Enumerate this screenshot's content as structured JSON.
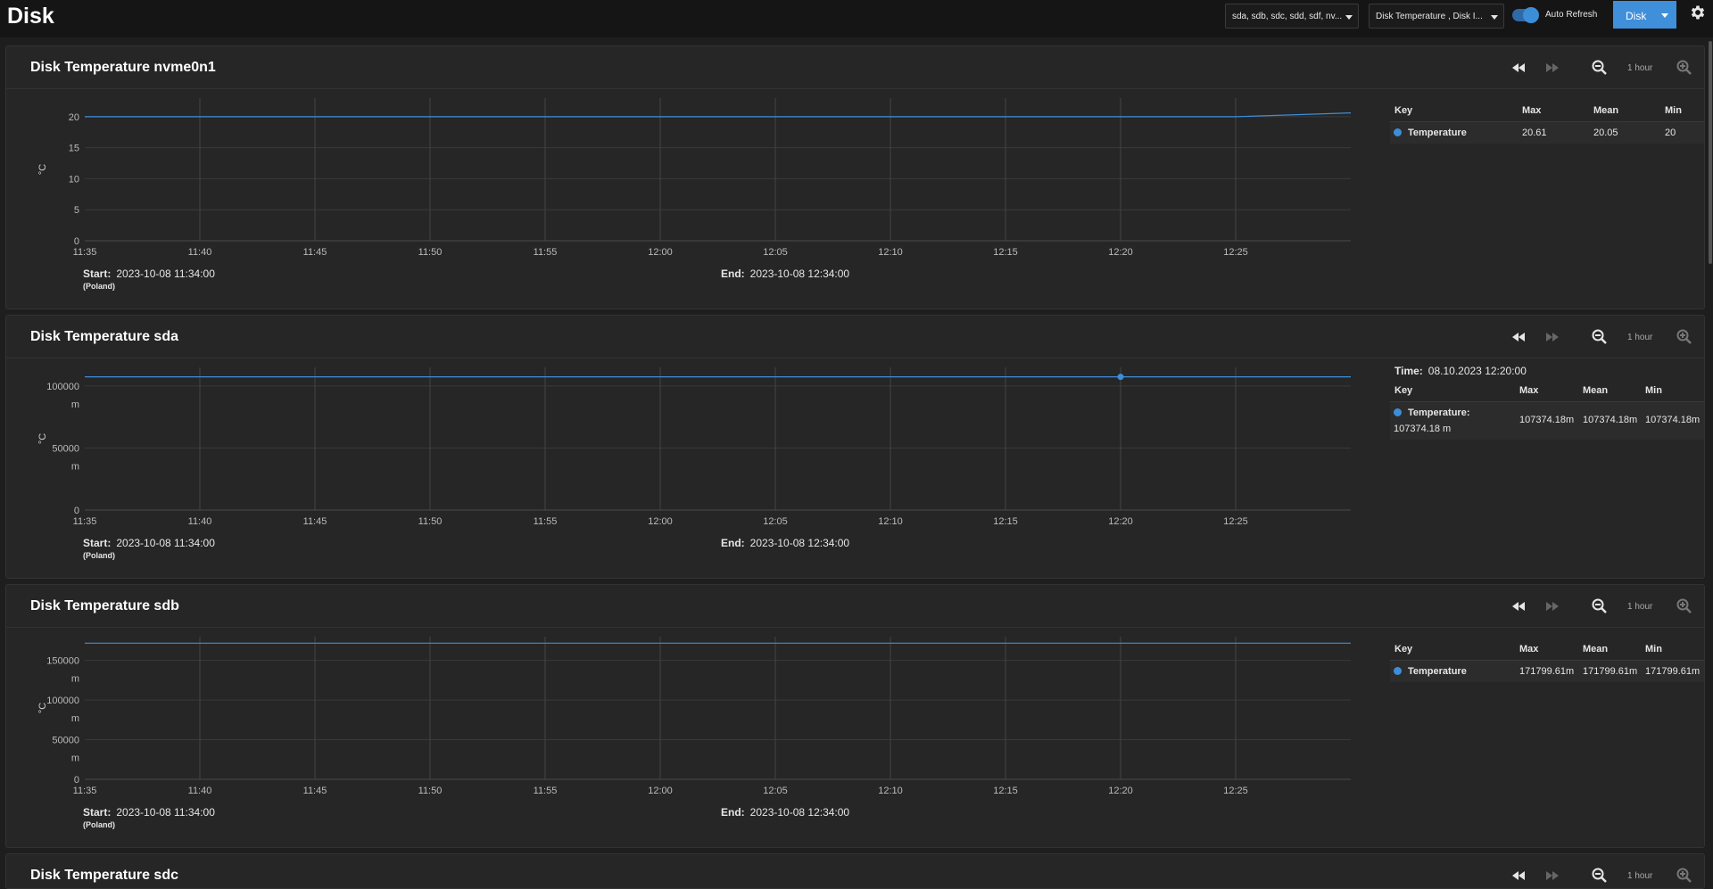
{
  "header": {
    "title": "Disk",
    "disk_select": "sda, sdb, sdc, sdd, sdf, nv...",
    "metric_select": "Disk Temperature , Disk I...",
    "auto_refresh_label": "Auto Refresh",
    "auto_refresh_on": true,
    "disk_button": "Disk"
  },
  "accent": "#3f8fdb",
  "series_color": "#3d8ed9",
  "icons": [
    "rewind-icon",
    "fast-forward-icon",
    "zoom-out-icon",
    "zoom-in-icon",
    "gear-icon",
    "chevron-down-icon"
  ],
  "cards": [
    {
      "title": "Disk Temperature nvme0n1",
      "range_label": "1 hour",
      "start_label": "Start:",
      "start_value": "2023-10-08 11:34:00",
      "timezone": "(Poland)",
      "end_label": "End:",
      "end_value": "2023-10-08 12:34:00",
      "legend": {
        "headers": [
          "Key",
          "Max",
          "Mean",
          "Min"
        ],
        "rows": [
          {
            "key": "Temperature",
            "max": "20.61",
            "mean": "20.05",
            "min": "20"
          }
        ]
      }
    },
    {
      "title": "Disk Temperature sda",
      "range_label": "1 hour",
      "start_label": "Start:",
      "start_value": "2023-10-08 11:34:00",
      "timezone": "(Poland)",
      "end_label": "End:",
      "end_value": "2023-10-08 12:34:00",
      "legend": {
        "time_label": "Time:",
        "time_value": "08.10.2023 12:20:00",
        "headers": [
          "Key",
          "Max",
          "Mean",
          "Min"
        ],
        "rows": [
          {
            "key": "Temperature:",
            "key_value": "107374.18 m",
            "max": "107374.18m",
            "mean": "107374.18m",
            "min": "107374.18m"
          }
        ]
      }
    },
    {
      "title": "Disk Temperature sdb",
      "range_label": "1 hour",
      "start_label": "Start:",
      "start_value": "2023-10-08 11:34:00",
      "timezone": "(Poland)",
      "end_label": "End:",
      "end_value": "2023-10-08 12:34:00",
      "legend": {
        "headers": [
          "Key",
          "Max",
          "Mean",
          "Min"
        ],
        "rows": [
          {
            "key": "Temperature",
            "max": "171799.61m",
            "mean": "171799.61m",
            "min": "171799.61m"
          }
        ]
      }
    },
    {
      "title": "Disk Temperature sdc",
      "range_label": "1 hour"
    }
  ],
  "chart_data": [
    {
      "type": "line",
      "ylabel": "°C",
      "x_ticks": [
        "11:35",
        "11:40",
        "11:45",
        "11:50",
        "11:55",
        "12:00",
        "12:05",
        "12:10",
        "12:15",
        "12:20",
        "12:25"
      ],
      "y_ticks": [
        "20",
        "15",
        "10",
        "5",
        "0"
      ],
      "ylim": [
        0,
        23
      ],
      "xlim": [
        "11:35",
        "12:30"
      ],
      "grid": true,
      "series": [
        {
          "name": "Temperature",
          "x": [
            "11:35",
            "12:25",
            "12:30"
          ],
          "y": [
            20,
            20,
            20.61
          ]
        }
      ]
    },
    {
      "type": "line",
      "ylabel": "°C",
      "x_ticks": [
        "11:35",
        "11:40",
        "11:45",
        "11:50",
        "11:55",
        "12:00",
        "12:05",
        "12:10",
        "12:15",
        "12:20",
        "12:25"
      ],
      "y_ticks": [
        {
          "value": 100000,
          "label": "100000",
          "unit": "m"
        },
        {
          "value": 50000,
          "label": "50000",
          "unit": "m"
        },
        {
          "value": 0,
          "label": "0",
          "unit": ""
        }
      ],
      "ylim": [
        0,
        115000
      ],
      "xlim": [
        "11:35",
        "12:30"
      ],
      "grid": true,
      "hover_x": "12:20",
      "series": [
        {
          "name": "Temperature",
          "x": [
            "11:35",
            "12:30"
          ],
          "y": [
            107374.18,
            107374.18
          ]
        }
      ]
    },
    {
      "type": "line",
      "ylabel": "°C",
      "x_ticks": [
        "11:35",
        "11:40",
        "11:45",
        "11:50",
        "11:55",
        "12:00",
        "12:05",
        "12:10",
        "12:15",
        "12:20",
        "12:25"
      ],
      "y_ticks": [
        {
          "value": 150000,
          "label": "150000",
          "unit": "m"
        },
        {
          "value": 100000,
          "label": "100000",
          "unit": "m"
        },
        {
          "value": 50000,
          "label": "50000",
          "unit": "m"
        },
        {
          "value": 0,
          "label": "0",
          "unit": ""
        }
      ],
      "ylim": [
        0,
        180000
      ],
      "xlim": [
        "11:35",
        "12:30"
      ],
      "grid": true,
      "series": [
        {
          "name": "Temperature",
          "x": [
            "11:35",
            "12:30"
          ],
          "y": [
            171799.61,
            171799.61
          ]
        }
      ]
    }
  ]
}
